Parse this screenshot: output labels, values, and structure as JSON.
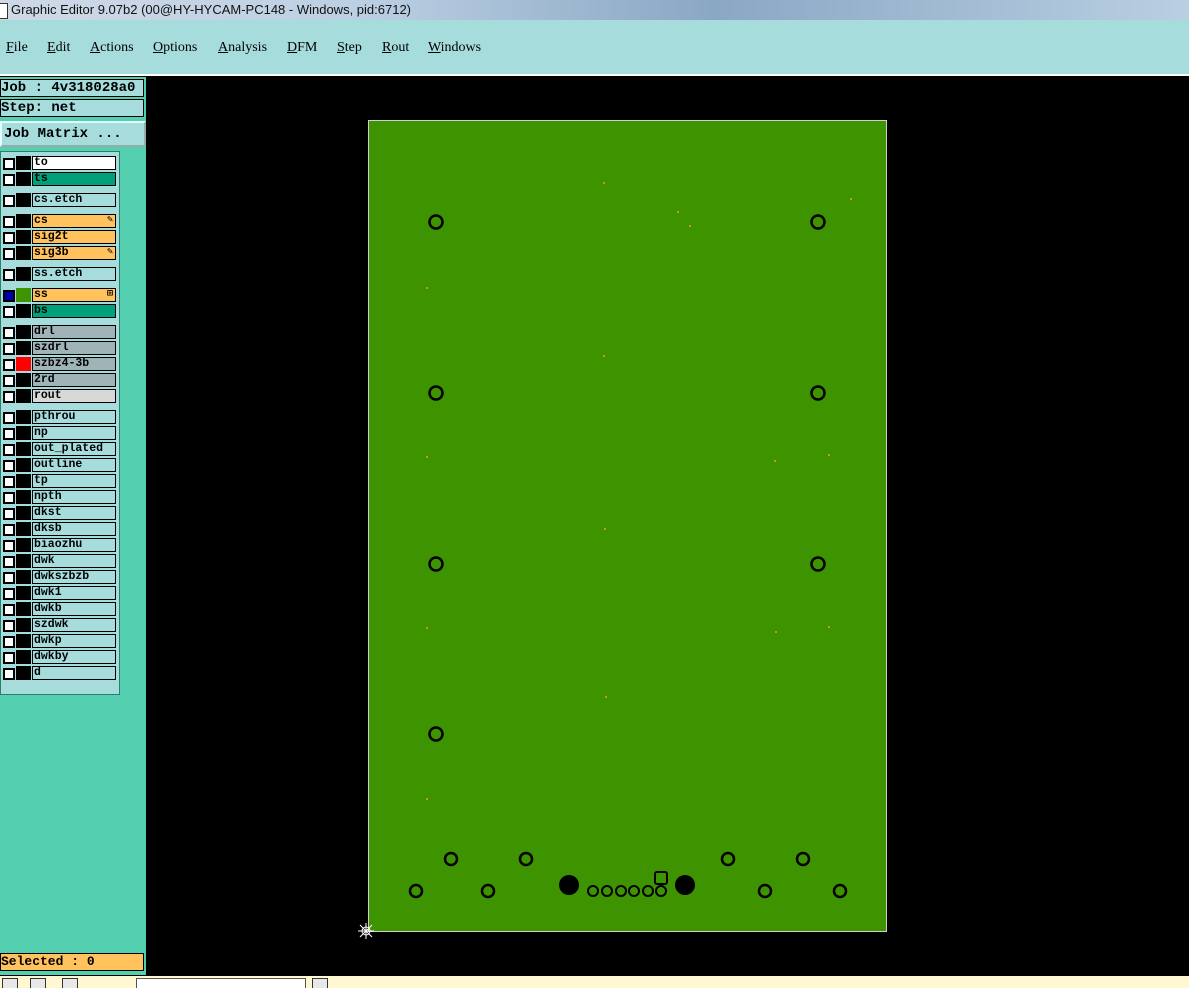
{
  "window": {
    "title": "Graphic Editor 9.07b2 (00@HY-HYCAM-PC148 - Windows, pid:6712)"
  },
  "menu": {
    "items": [
      {
        "label": "File",
        "key": "F",
        "rest": "ile"
      },
      {
        "label": "Edit",
        "key": "E",
        "rest": "dit"
      },
      {
        "label": "Actions",
        "key": "A",
        "rest": "ctions"
      },
      {
        "label": "Options",
        "key": "O",
        "rest": "ptions"
      },
      {
        "label": "Analysis",
        "key": "A",
        "rest": "nalysis"
      },
      {
        "label": "DFM",
        "key": "D",
        "rest": "FM"
      },
      {
        "label": "Step",
        "key": "S",
        "rest": "tep"
      },
      {
        "label": "Rout",
        "key": "R",
        "rest": "out"
      },
      {
        "label": "Windows",
        "key": "W",
        "rest": "indows"
      }
    ]
  },
  "job": {
    "job_label": "Job : 4v318028a0",
    "step_label": "Step: net",
    "matrix_button": "Job Matrix ..."
  },
  "layers": [
    {
      "name": "to",
      "color": "#ffffff",
      "swatch": "#000000",
      "checked": false,
      "mark": ""
    },
    {
      "name": "ts",
      "color": "#00a07a",
      "swatch": "#000000",
      "checked": false,
      "mark": ""
    },
    {
      "name": "cs.etch",
      "color": "#a6dcdc",
      "swatch": "#000000",
      "checked": false,
      "mark": ""
    },
    {
      "name": "cs",
      "color": "#ffc25c",
      "swatch": "#000000",
      "checked": false,
      "mark": "✎"
    },
    {
      "name": "sig2t",
      "color": "#ffc25c",
      "swatch": "#000000",
      "checked": false,
      "mark": ""
    },
    {
      "name": "sig3b",
      "color": "#ffc25c",
      "swatch": "#000000",
      "checked": false,
      "mark": "✎"
    },
    {
      "name": "ss.etch",
      "color": "#a6dcdc",
      "swatch": "#000000",
      "checked": false,
      "mark": ""
    },
    {
      "name": "ss",
      "color": "#ffc25c",
      "swatch": "#3e9400",
      "checked": true,
      "mark": "⊞"
    },
    {
      "name": "bs",
      "color": "#00a07a",
      "swatch": "#000000",
      "checked": false,
      "mark": ""
    },
    {
      "name": "drl",
      "color": "#a0b4b8",
      "swatch": "#000000",
      "checked": false,
      "mark": ""
    },
    {
      "name": "szdrl",
      "color": "#a0b4b8",
      "swatch": "#000000",
      "checked": false,
      "mark": ""
    },
    {
      "name": "szbz4-3b",
      "color": "#a0b4b8",
      "swatch": "#ff0000",
      "checked": false,
      "mark": ""
    },
    {
      "name": "2rd",
      "color": "#a0b4b8",
      "swatch": "#000000",
      "checked": false,
      "mark": ""
    },
    {
      "name": "rout",
      "color": "#d8d8d8",
      "swatch": "#000000",
      "checked": false,
      "mark": ""
    },
    {
      "name": "pthrou",
      "color": "#a6dcdc",
      "swatch": "#000000",
      "checked": false,
      "mark": ""
    },
    {
      "name": "np",
      "color": "#a6dcdc",
      "swatch": "#000000",
      "checked": false,
      "mark": ""
    },
    {
      "name": "out_plated",
      "color": "#a6dcdc",
      "swatch": "#000000",
      "checked": false,
      "mark": ""
    },
    {
      "name": "outline",
      "color": "#a6dcdc",
      "swatch": "#000000",
      "checked": false,
      "mark": ""
    },
    {
      "name": "tp",
      "color": "#a6dcdc",
      "swatch": "#000000",
      "checked": false,
      "mark": ""
    },
    {
      "name": "npth",
      "color": "#a6dcdc",
      "swatch": "#000000",
      "checked": false,
      "mark": ""
    },
    {
      "name": "dkst",
      "color": "#a6dcdc",
      "swatch": "#000000",
      "checked": false,
      "mark": ""
    },
    {
      "name": "dksb",
      "color": "#a6dcdc",
      "swatch": "#000000",
      "checked": false,
      "mark": ""
    },
    {
      "name": "biaozhu",
      "color": "#a6dcdc",
      "swatch": "#000000",
      "checked": false,
      "mark": ""
    },
    {
      "name": "dwk",
      "color": "#a6dcdc",
      "swatch": "#000000",
      "checked": false,
      "mark": ""
    },
    {
      "name": "dwkszbzb",
      "color": "#a6dcdc",
      "swatch": "#000000",
      "checked": false,
      "mark": ""
    },
    {
      "name": "dwk1",
      "color": "#a6dcdc",
      "swatch": "#000000",
      "checked": false,
      "mark": ""
    },
    {
      "name": "dwkb",
      "color": "#a6dcdc",
      "swatch": "#000000",
      "checked": false,
      "mark": ""
    },
    {
      "name": "szdwk",
      "color": "#a6dcdc",
      "swatch": "#000000",
      "checked": false,
      "mark": ""
    },
    {
      "name": "dwkp",
      "color": "#a6dcdc",
      "swatch": "#000000",
      "checked": false,
      "mark": ""
    },
    {
      "name": "dwkby",
      "color": "#a6dcdc",
      "swatch": "#000000",
      "checked": false,
      "mark": ""
    },
    {
      "name": "d",
      "color": "#a6dcdc",
      "swatch": "#000000",
      "checked": false,
      "mark": ""
    }
  ],
  "status": {
    "selected": "Selected : 0"
  },
  "colors": {
    "board": "#3e9400",
    "canvas": "#000000",
    "panel": "#54cfb0",
    "menubar": "#a6dcdc"
  }
}
